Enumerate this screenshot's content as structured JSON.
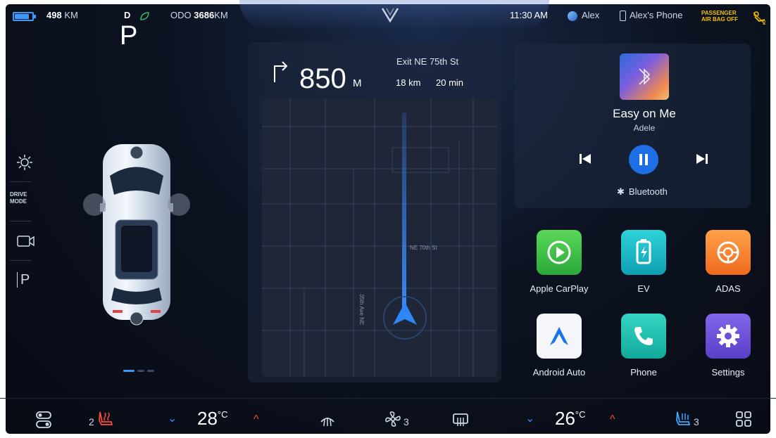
{
  "status_bar": {
    "range_value": "498",
    "range_unit": "KM",
    "drive_gear": "D",
    "odo_label": "ODO",
    "odo_value": "3686",
    "odo_unit": "KM",
    "time": "11:30 AM",
    "user": "Alex",
    "phone": "Alex's Phone",
    "airbag_line1": "PASSENGER",
    "airbag_line2": "AIR BAG OFF"
  },
  "vehicle": {
    "gear": "P",
    "drive_mode_line1": "DRIVE",
    "drive_mode_line2": "MODE",
    "park_label": "P"
  },
  "navigation": {
    "distance": "850",
    "distance_unit": "M",
    "exit": "Exit NE 75th St",
    "remaining_km": "18 km",
    "remaining_min": "20 min",
    "street_1": "NE 70th St",
    "street_2": "35th Ave NE"
  },
  "media": {
    "song": "Easy on Me",
    "artist": "Adele",
    "source": "Bluetooth"
  },
  "apps": [
    {
      "label": "Apple CarPlay",
      "color": "#35c24a"
    },
    {
      "label": "EV",
      "color": "#17b6c4"
    },
    {
      "label": "ADAS",
      "color": "#f27a2a"
    },
    {
      "label": "Android Auto",
      "color": "#f4f6fa"
    },
    {
      "label": "Phone",
      "color": "#1fbfae"
    },
    {
      "label": "Settings",
      "color": "#6e52d8"
    }
  ],
  "climate": {
    "left_seat_level": "2",
    "left_temp": "28",
    "right_temp": "26",
    "temp_unit": "°C",
    "fan_level": "3",
    "right_seat_level": "3"
  },
  "colors": {
    "accent": "#3a9bff",
    "heat": "#ff4a3a"
  }
}
